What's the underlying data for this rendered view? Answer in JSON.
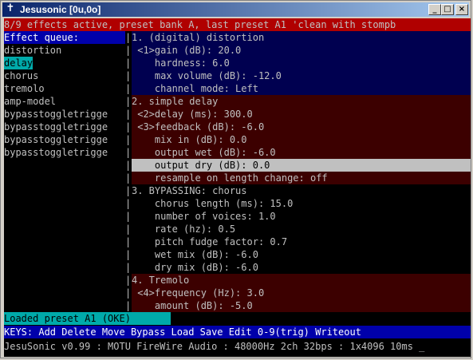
{
  "window": {
    "title": "Jesusonic [0u,0o]",
    "icon": "cross-icon",
    "minimize_glyph": "_",
    "maximize_glyph": "□",
    "close_glyph": "×"
  },
  "status_line": "8/9 effects active, preset bank A, last preset A1 'clean with stompb",
  "queue": {
    "header": "Effect queue:",
    "items": [
      "distortion",
      "delay",
      "chorus",
      "tremolo",
      "amp-model",
      "bypasstoggletrigge",
      "bypasstoggletrigge",
      "bypasstoggletrigge",
      "bypasstoggletrigge"
    ],
    "selected_index": 1
  },
  "separator": "|",
  "effects": [
    {
      "title": "1. (digital) distortion",
      "params": [
        " <1>gain (dB): 20.0",
        "    hardness: 6.0",
        "    max volume (dB): -12.0",
        "    channel mode: Left"
      ]
    },
    {
      "title": "2. simple delay",
      "params": [
        " <2>delay (ms): 300.0",
        " <3>feedback (dB): -6.0",
        "    mix in (dB): 0.0",
        "    output wet (dB): -6.0",
        "    output dry (dB): 0.0",
        "    resample on length change: off"
      ],
      "highlighted_param": 4
    },
    {
      "title": "3. BYPASSING: chorus",
      "params": [
        "    chorus length (ms): 15.0",
        "    number of voices: 1.0",
        "    rate (hz): 0.5",
        "    pitch fudge factor: 0.7",
        "    wet mix (dB): -6.0",
        "    dry mix (dB): -6.0"
      ]
    },
    {
      "title": "4. Tremolo",
      "params": [
        " <4>frequency (Hz): 3.0",
        "    amount (dB): -5.0"
      ]
    }
  ],
  "loaded_message": "Loaded preset A1 (OKE)",
  "keys_line": "KEYS: Add Delete Move Bypass Load Save Edit 0-9(trig) Writeout",
  "version_line": "JesuSonic v0.99 : MOTU FireWire Audio : 48000Hz 2ch 32bps : 1x4096 10ms _",
  "colors": {
    "status_bg": "#b00000",
    "header_bg": "#0000aa",
    "selected_bg": "#00aaaa",
    "effect1_bg": "#000050",
    "effect2_bg": "#3c0000",
    "highlight_bg": "#c0c0c0"
  }
}
